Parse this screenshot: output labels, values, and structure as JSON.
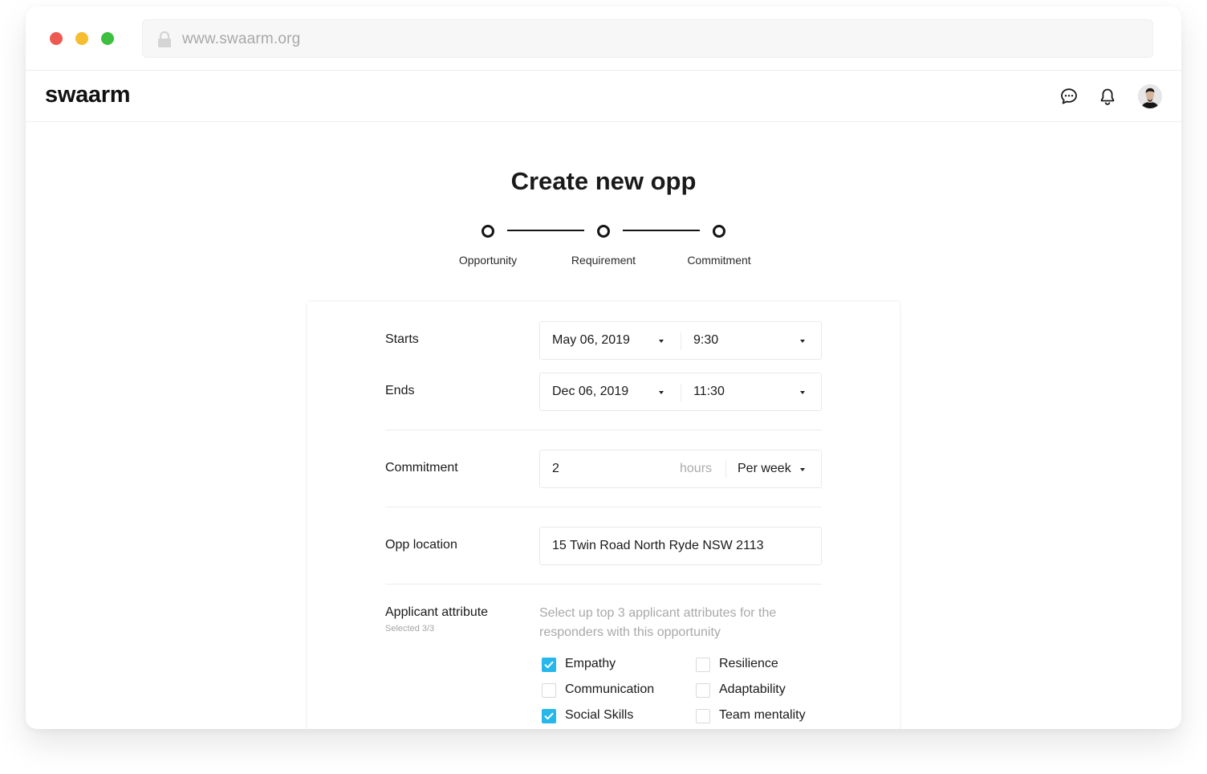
{
  "browser": {
    "url": "www.swaarm.org",
    "traffic_lights": {
      "close": "#ee5a52",
      "minimize": "#f5bd2f",
      "zoom": "#3dc040"
    }
  },
  "header": {
    "logo": "swaarm",
    "icons": [
      "chat-bubble-icon",
      "bell-icon",
      "avatar"
    ]
  },
  "page": {
    "title": "Create new opp"
  },
  "stepper": {
    "steps": [
      {
        "label": "Opportunity"
      },
      {
        "label": "Requirement"
      },
      {
        "label": "Commitment"
      }
    ]
  },
  "form": {
    "starts": {
      "label": "Starts",
      "date": "May 06, 2019",
      "time": "9:30"
    },
    "ends": {
      "label": "Ends",
      "date": "Dec 06, 2019",
      "time": "11:30"
    },
    "commitment": {
      "label": "Commitment",
      "value": "2",
      "unit": "hours",
      "period": "Per week"
    },
    "location": {
      "label": "Opp location",
      "value": "15 Twin Road North Ryde NSW 2113"
    },
    "attributes": {
      "label": "Applicant attribute",
      "selected_count": "Selected 3/3",
      "hint": "Select up top 3 applicant attributes for the responders with this opportunity",
      "options": [
        {
          "label": "Empathy",
          "checked": true
        },
        {
          "label": "Resilience",
          "checked": false
        },
        {
          "label": "Communication",
          "checked": false
        },
        {
          "label": "Adaptability",
          "checked": false
        },
        {
          "label": "Social Skills",
          "checked": true
        },
        {
          "label": "Team mentality",
          "checked": false
        }
      ]
    }
  },
  "colors": {
    "accent": "#26b8ea",
    "text": "#1a1a1a",
    "muted": "#a9a9a9"
  }
}
